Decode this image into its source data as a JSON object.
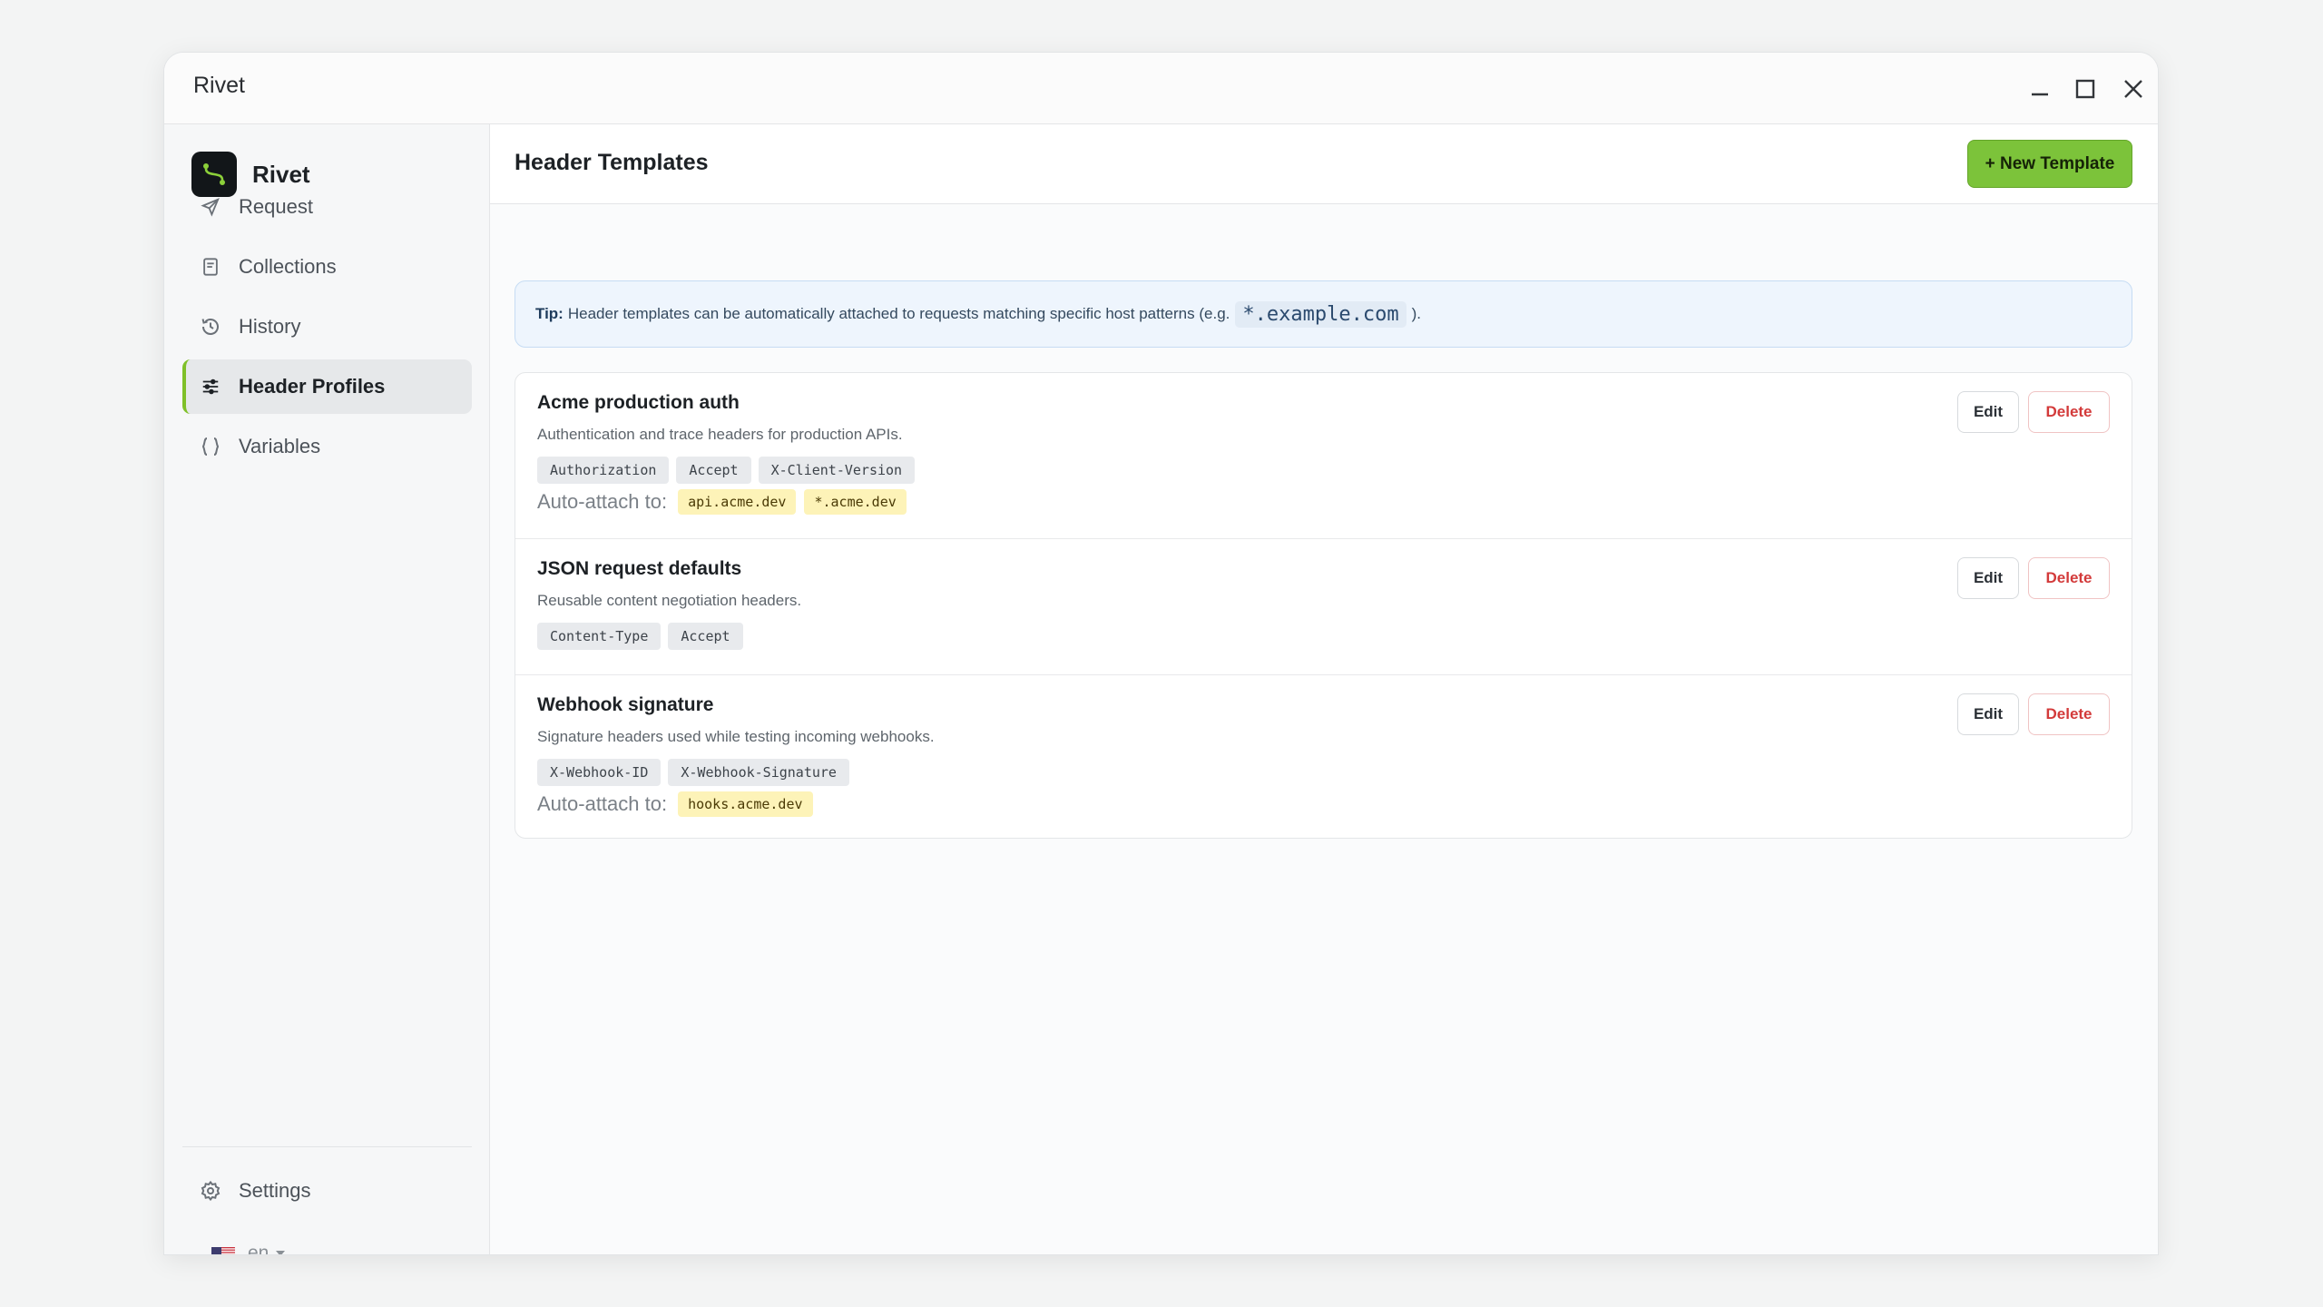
{
  "window": {
    "title": "Rivet"
  },
  "sidebar": {
    "brand": "Rivet",
    "items": [
      {
        "label": "Request",
        "icon": "send-icon"
      },
      {
        "label": "Collections",
        "icon": "collections-icon"
      },
      {
        "label": "History",
        "icon": "history-icon"
      },
      {
        "label": "Header Profiles",
        "icon": "sliders-icon",
        "active": true
      },
      {
        "label": "Variables",
        "icon": "braces-icon"
      }
    ],
    "settings": {
      "label": "Settings",
      "icon": "gear-icon"
    },
    "language": {
      "code": "en",
      "flag": "us-flag-icon"
    }
  },
  "header": {
    "title": "Header Templates",
    "new_button": "+ New Template"
  },
  "tip": {
    "label": "Tip:",
    "text": "Header templates can be automatically attached to requests matching specific host patterns (e.g.",
    "example": "*.example.com",
    "suffix": ")."
  },
  "templates": [
    {
      "name": "Acme production auth",
      "description": "Authentication and trace headers for production APIs.",
      "headers": [
        "Authorization",
        "Accept",
        "X-Client-Version"
      ],
      "auto_attach_label": "Auto-attach to:",
      "hosts": [
        "api.acme.dev",
        "*.acme.dev"
      ],
      "edit": "Edit",
      "delete": "Delete"
    },
    {
      "name": "JSON request defaults",
      "description": "Reusable content negotiation headers.",
      "headers": [
        "Content-Type",
        "Accept"
      ],
      "edit": "Edit",
      "delete": "Delete"
    },
    {
      "name": "Webhook signature",
      "description": "Signature headers used while testing incoming webhooks.",
      "headers": [
        "X-Webhook-ID",
        "X-Webhook-Signature"
      ],
      "auto_attach_label": "Auto-attach to:",
      "hosts": [
        "hooks.acme.dev"
      ],
      "edit": "Edit",
      "delete": "Delete"
    }
  ],
  "colors": {
    "accent": "#7cc33a",
    "danger": "#d33a3a",
    "tip_bg": "#eef5fd",
    "host_bg": "#fdf3b8"
  }
}
